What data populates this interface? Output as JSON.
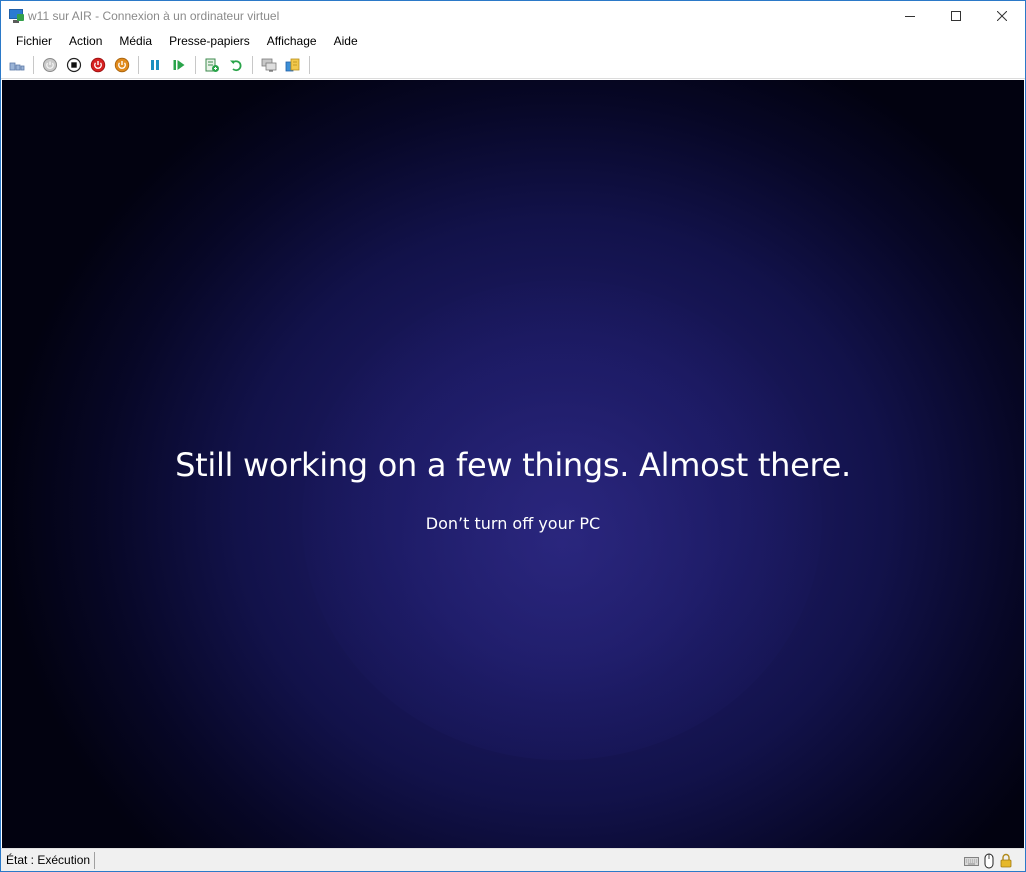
{
  "window": {
    "title": "w11 sur AIR - Connexion à un ordinateur virtuel"
  },
  "menu": {
    "items": [
      "Fichier",
      "Action",
      "Média",
      "Presse-papiers",
      "Affichage",
      "Aide"
    ]
  },
  "toolbar": {
    "icons": [
      "ctrl-alt-del-icon",
      "start-icon",
      "turn-off-icon",
      "shut-down-icon",
      "save-icon",
      "pause-icon",
      "resume-icon",
      "checkpoint-icon",
      "revert-icon",
      "enhanced-session-icon",
      "share-icon"
    ]
  },
  "vm": {
    "main_text": "Still working on a few things. Almost there.",
    "sub_text": "Don’t turn off your PC"
  },
  "status": {
    "label": "État : Exécution"
  },
  "colors": {
    "accent_border": "#2b79c8",
    "vm_background": "#1c1a62",
    "stop_red": "#d62020",
    "save_orange": "#e08a1c",
    "green": "#2aa44a",
    "pause_teal": "#1a8fbf"
  }
}
